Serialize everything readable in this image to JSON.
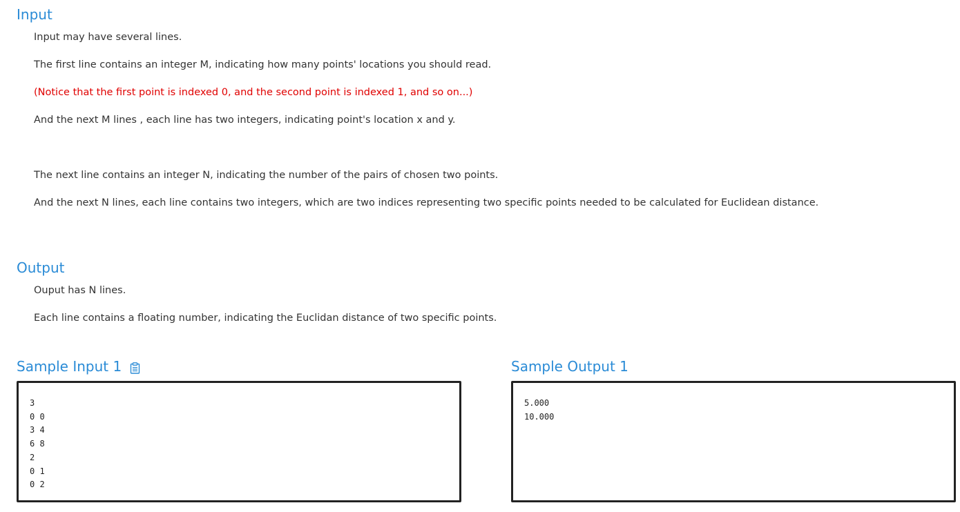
{
  "input_section": {
    "heading": "Input",
    "lines": [
      "Input may have several lines.",
      "The first line contains an integer M, indicating how many points' locations you should read.",
      "(Notice that the first point is indexed 0, and the second point is indexed 1, and so on...)",
      "And the next M lines , each line has two integers, indicating point's location x and y.",
      "The next line contains an integer N, indicating the number of the pairs of chosen two points.",
      "And the next N lines, each line contains two integers, which are two indices representing two specific points needed to be calculated for Euclidean distance."
    ]
  },
  "output_section": {
    "heading": "Output",
    "lines": [
      "Ouput has N lines.",
      "Each line contains a floating number, indicating the Euclidan distance of two specific points."
    ]
  },
  "sample_input": {
    "title": "Sample Input 1",
    "content": "3\n0 0\n3 4\n6 8\n2\n0 1\n0 2"
  },
  "sample_output": {
    "title": "Sample Output 1",
    "content": "5.000\n10.000"
  },
  "colors": {
    "heading": "#2a8bd6",
    "notice_text": "#e00000",
    "body_text": "#333333",
    "box_border": "#222222"
  },
  "icons": {
    "copy": "clipboard-icon"
  }
}
